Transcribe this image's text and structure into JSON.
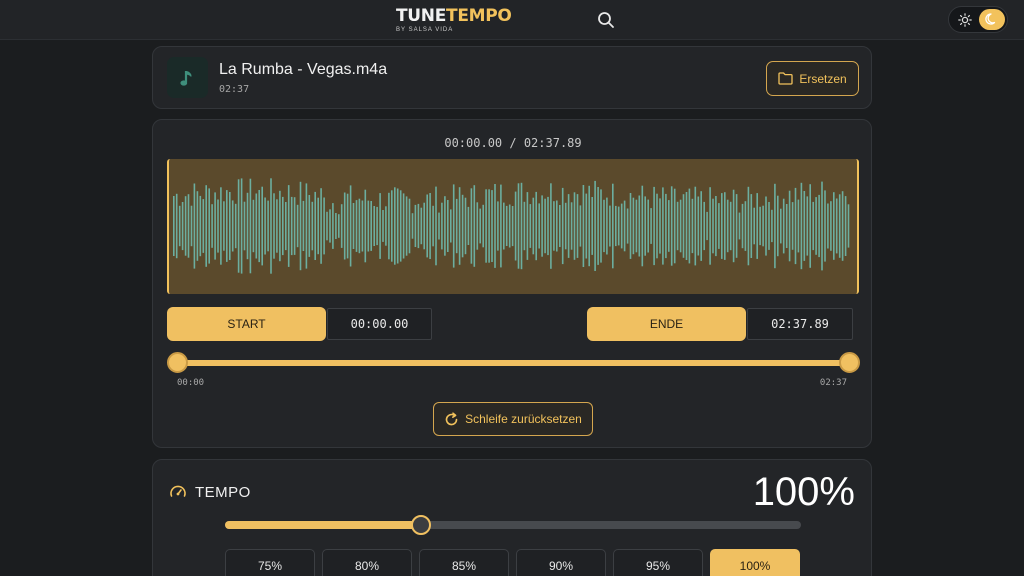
{
  "header": {
    "logo_part1": "TUNE",
    "logo_part2": "TEMPO",
    "logo_sub": "BY SALSA VIDA",
    "search_icon": "search-icon",
    "theme_toggle": {
      "left_icon": "sun-icon",
      "right_icon": "moon-icon",
      "active": "dark"
    }
  },
  "file": {
    "icon": "music-note-icon",
    "name": "La Rumba - Vegas.m4a",
    "duration": "02:37",
    "replace_label": "Ersetzen",
    "replace_icon": "folder-icon"
  },
  "loop": {
    "time_readout": "00:00.00 / 02:37.89",
    "start_label": "START",
    "start_time": "00:00.00",
    "end_label": "ENDE",
    "end_time": "02:37.89",
    "range_min_label": "00:00",
    "range_max_label": "02:37",
    "range_start_fraction": 0,
    "range_end_fraction": 1,
    "reset_label": "Schleife zurücksetzen",
    "reset_icon": "reset-icon"
  },
  "tempo": {
    "icon": "gauge-icon",
    "label": "TEMPO",
    "value": "100%",
    "slider_fraction": 0.34,
    "presets": [
      "75%",
      "80%",
      "85%",
      "90%",
      "95%",
      "100%"
    ],
    "active_preset": "100%"
  },
  "colors": {
    "accent": "#f0c061",
    "background": "#1b1d1f",
    "card": "#232528",
    "waveform_bar": "#6cae9f",
    "waveform_bg": "#5b4a2c"
  }
}
